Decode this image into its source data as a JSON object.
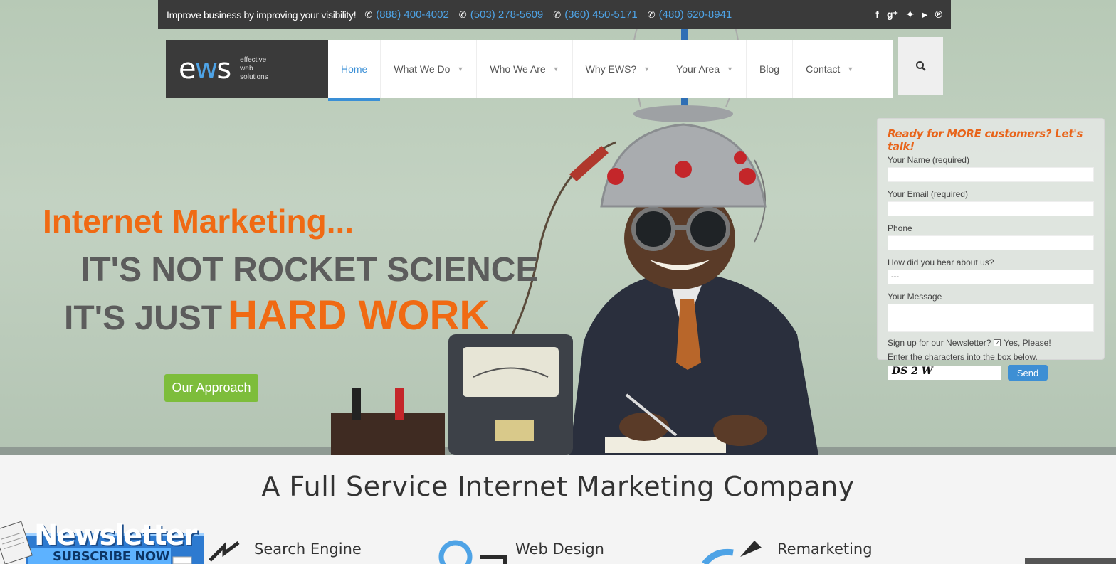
{
  "topbar": {
    "tagline": "Improve business by improving your visibility!",
    "phones": [
      "(888) 400-4002",
      "(503) 278-5609",
      "(360) 450-5171",
      "(480) 620-8941"
    ],
    "socials": [
      "facebook-icon",
      "google-plus-icon",
      "twitter-icon",
      "youtube-icon",
      "pinterest-icon"
    ]
  },
  "logo": {
    "mark": "ews",
    "sub1": "effective",
    "sub2": "web",
    "sub3": "solutions"
  },
  "nav": {
    "items": [
      "Home",
      "What We Do",
      "Who We Are",
      "Why EWS?",
      "Your Area",
      "Blog",
      "Contact"
    ],
    "active": "Home"
  },
  "hero": {
    "line1": "Internet Marketing...",
    "line2": "IT'S NOT ROCKET SCIENCE",
    "line3": "IT'S JUST",
    "line3b": "HARD WORK",
    "button": "Our Approach"
  },
  "form": {
    "title": "Ready for MORE customers? Let's talk!",
    "name_label": "Your Name (required)",
    "email_label": "Your Email (required)",
    "phone_label": "Phone",
    "hear_label": "How did you hear about us?",
    "hear_value": "---",
    "message_label": "Your Message",
    "newsletter_label": "Sign up for our Newsletter?",
    "newsletter_option": "Yes, Please!",
    "captcha_label": "Enter the characters into the box below.",
    "captcha_text": "DS 2 W",
    "send": "Send"
  },
  "lower": {
    "headline": "A Full Service Internet Marketing Company",
    "services": [
      "Search Engine",
      "Web Design",
      "Remarketing"
    ]
  },
  "newsletter_banner": {
    "title": "Newsletter",
    "subtitle": "SUBSCRIBE NOW"
  },
  "colors": {
    "accent_blue": "#3a8fd6",
    "accent_orange": "#f06a13",
    "green_button": "#7dbd3b",
    "dark_bar": "#3a3a3a"
  }
}
